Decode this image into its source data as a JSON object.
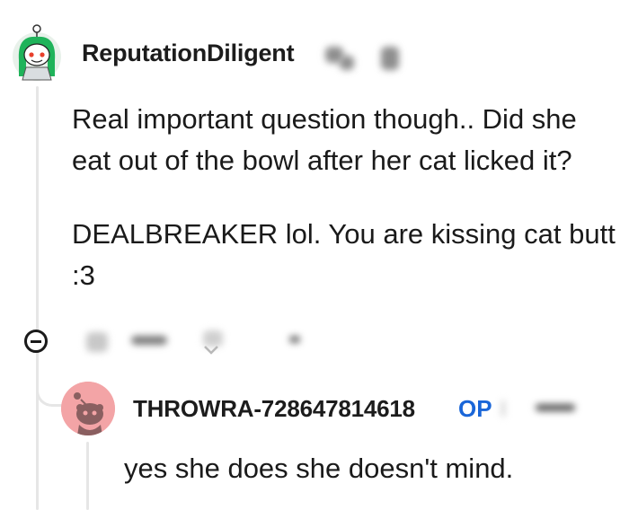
{
  "comment": {
    "author": "ReputationDiligent",
    "avatar_icon": "snoo-green-hair-avatar-icon",
    "paragraphs": [
      "Real important question though.. Did she eat out of the bowl after her cat licked it?",
      "DEALBREAKER lol. You are kissing cat butt :3"
    ],
    "actions": [
      "upvote-icon",
      "vote-count",
      "downvote-icon",
      "reply-icon",
      "more-options-icon"
    ]
  },
  "reply": {
    "author": "THROWRA-728647814618",
    "badge": "OP",
    "avatar_icon": "snoo-default-avatar-icon",
    "avatar_color": "#f3a4a6",
    "text": "yes she does she doesn't mind."
  },
  "colors": {
    "accent_blue": "#1a66d8",
    "thread_line": "#e6e6e6",
    "text": "#1c1c1c"
  }
}
